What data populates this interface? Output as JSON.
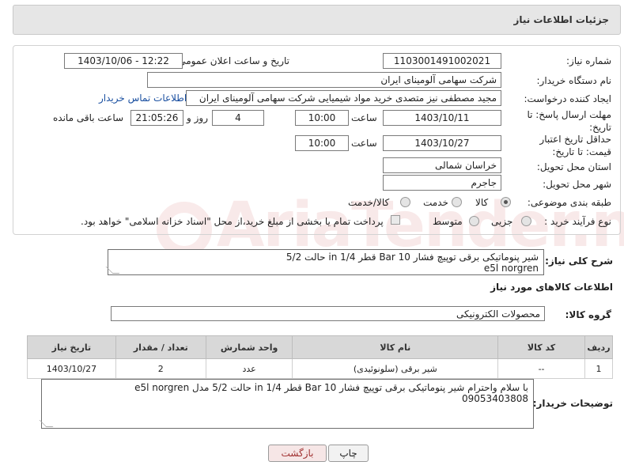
{
  "header": {
    "title": "جزئیات اطلاعات نیاز"
  },
  "form": {
    "need_number_label": "شماره نیاز:",
    "need_number": "1103001491002021",
    "announce_label": "تاریخ و ساعت اعلان عمومی:",
    "announce_value": "1403/10/06 - 12:22",
    "buyer_org_label": "نام دستگاه خریدار:",
    "buyer_org": "شرکت سهامی آلومینای ایران",
    "requester_label": "ایجاد کننده درخواست:",
    "requester": "مجید مصطفی نیز متصدی خرید مواد شیمیایی شرکت سهامی آلومینای ایران",
    "contact_link": "اطلاعات تماس خریدار",
    "deadline_label": "مهلت ارسال پاسخ: تا تاریخ:",
    "deadline_date": "1403/10/11",
    "time_label": "ساعت",
    "deadline_time": "10:00",
    "days_value": "4",
    "days_label": "روز و",
    "remaining_time": "21:05:26",
    "remaining_label": "ساعت باقی مانده",
    "validity_label": "حداقل تاریخ اعتبار قیمت: تا تاریخ:",
    "validity_date": "1403/10/27",
    "validity_time": "10:00",
    "province_label": "استان محل تحویل:",
    "province": "خراسان شمالی",
    "city_label": "شهر محل تحویل:",
    "city": "جاجرم",
    "category_label": "طبقه بندی موضوعی:",
    "category_options": [
      "کالا",
      "خدمت",
      "کالا/خدمت"
    ],
    "process_label": "نوع فرآیند خرید :",
    "process_options": [
      "جزیی",
      "متوسط"
    ],
    "payment_note": "پرداخت تمام یا بخشی از مبلغ خرید،از محل \"اسناد خزانه اسلامی\" خواهد بود."
  },
  "description": {
    "label": "شرح کلی نیاز:",
    "line1": "شیر پنوماتیکی برقی توپیچ فشار 10 Bar قطر 1/4 in حالت 5/2",
    "line2": "e5l  norgren"
  },
  "goods": {
    "section_title": "اطلاعات کالاهای مورد نیاز",
    "group_label": "گروه کالا:",
    "group_value": "محصولات الکترونیکی",
    "columns": [
      "ردیف",
      "کد کالا",
      "نام کالا",
      "واحد شمارش",
      "تعداد / مقدار",
      "تاریخ نیاز"
    ],
    "rows": [
      {
        "index": "1",
        "code": "--",
        "name": "شیر برقی (سلونوئیدی)",
        "unit": "عدد",
        "qty": "2",
        "date": "1403/10/27"
      }
    ]
  },
  "buyer_notes": {
    "label": "توضیحات خریدار:",
    "line1": "با سلام واحترام شیر پنوماتیکی برقی توپیچ فشار 10 Bar قطر 1/4 in حالت 5/2  مدل  e5l  norgren",
    "line2": "09053403808"
  },
  "buttons": {
    "print": "چاپ",
    "back": "بازگشت"
  },
  "watermark": "AriaTender.neT"
}
